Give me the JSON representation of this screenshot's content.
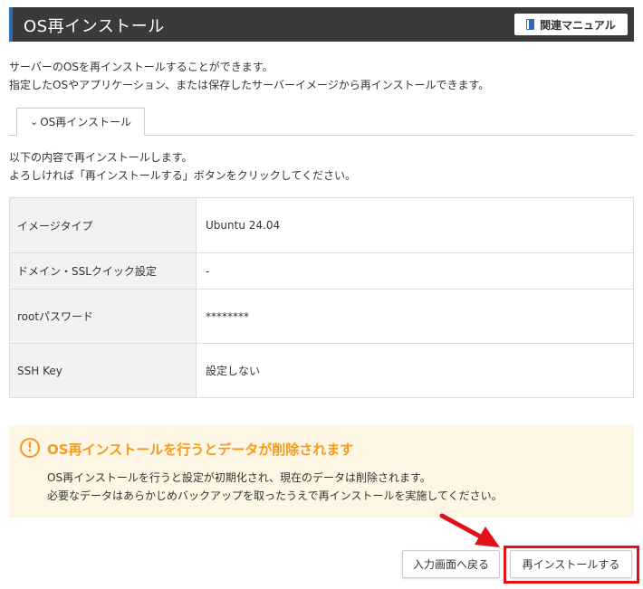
{
  "header": {
    "title": "OS再インストール",
    "manual_label": "関連マニュアル",
    "accent_color": "#2d6fb3"
  },
  "description": {
    "line1": "サーバーのOSを再インストールすることができます。",
    "line2": "指定したOSやアプリケーション、または保存したサーバーイメージから再インストールできます。"
  },
  "tab": {
    "label": "OS再インストール"
  },
  "intro": {
    "line1": "以下の内容で再インストールします。",
    "line2": "よろしければ「再インストールする」ボタンをクリックしてください。"
  },
  "settings": [
    {
      "label": "イメージタイプ",
      "value": "Ubuntu 24.04"
    },
    {
      "label": "ドメイン・SSLクイック設定",
      "value": "-"
    },
    {
      "label": "rootパスワード",
      "value": "********"
    },
    {
      "label": "SSH Key",
      "value": "設定しない"
    }
  ],
  "warning": {
    "icon": "exclamation-circle-icon",
    "title": "OS再インストールを行うとデータが削除されます",
    "line1": "OS再インストールを行うと設定が初期化され、現在のデータは削除されます。",
    "line2": "必要なデータはあらかじめバックアップを取ったうえで再インストールを実施してください。",
    "color": "#f29b1d",
    "background": "#fdf6e4"
  },
  "actions": {
    "back_label": "入力画面へ戻る",
    "reinstall_label": "再インストールする",
    "highlight_color": "#e3101a"
  }
}
